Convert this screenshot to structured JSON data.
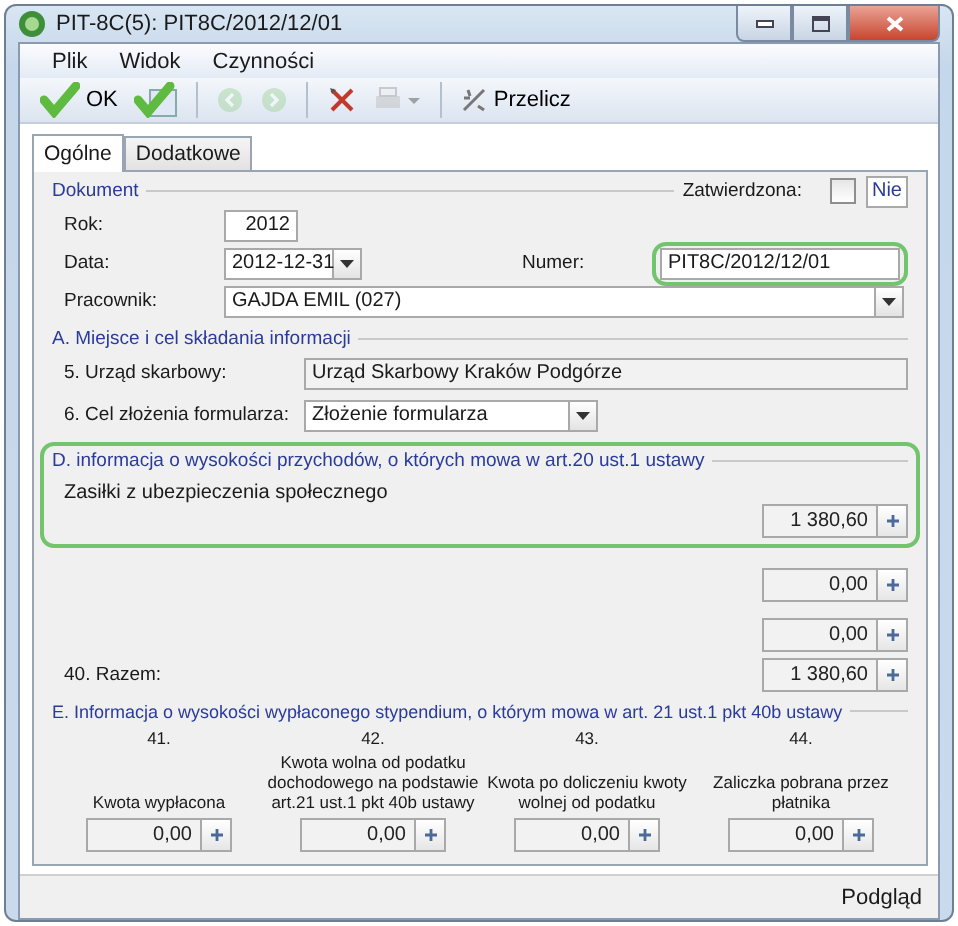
{
  "window": {
    "title": "PIT-8C(5): PIT8C/2012/12/01"
  },
  "menu": [
    "Plik",
    "Widok",
    "Czynności"
  ],
  "toolbar": [
    {
      "kind": "ok",
      "label": "OK",
      "disabled": false
    },
    {
      "kind": "check",
      "disabled": false
    },
    {
      "kind": "prev",
      "disabled": true
    },
    {
      "kind": "next",
      "disabled": true
    },
    {
      "kind": "tools",
      "disabled": false
    },
    {
      "kind": "print",
      "disabled": true
    },
    {
      "kind": "recalc",
      "label": "Przelicz",
      "disabled": false
    }
  ],
  "tabs": [
    {
      "label": "Ogólne",
      "selected": true
    },
    {
      "label": "Dodatkowe",
      "selected": false
    }
  ],
  "document": {
    "legend": "Dokument",
    "approved_label": "Zatwierdzona:",
    "approved": false,
    "approved_text": "Nie",
    "year_label": "Rok:",
    "year": "2012",
    "date_label": "Data:",
    "date": "2012-12-31",
    "number_label": "Numer:",
    "number": "PIT8C/2012/12/01",
    "number_highlighted": true,
    "employee_label": "Pracownik:",
    "employee": "GAJDA EMIL (027)"
  },
  "section_a": {
    "legend": "A. Miejsce i cel składania informacji",
    "office_label": "5. Urząd skarbowy:",
    "office": "Urząd Skarbowy Kraków Podgórze",
    "purpose_label": "6. Cel złożenia formularza:",
    "purpose": "Złożenie formularza"
  },
  "section_d": {
    "legend": "D. informacja o wysokości przychodów, o których mowa w art.20 ust.1 ustawy",
    "highlighted": true,
    "item_label": "Zasiłki z ubezpieczenia społecznego",
    "item_value": "1 380,60",
    "extra_values": [
      "0,00",
      "0,00"
    ],
    "total_label": "40. Razem:",
    "total": "1 380,60"
  },
  "section_e": {
    "legend": "E. Informacja o wysokości wypłaconego stypendium, o którym mowa w art. 21 ust.1 pkt 40b ustawy",
    "columns": [
      {
        "number": "41.",
        "label": "Kwota wypłacona",
        "value": "0,00"
      },
      {
        "number": "42.",
        "label": "Kwota wolna od podatku dochodowego na podstawie art.21 ust.1 pkt 40b ustawy",
        "value": "0,00"
      },
      {
        "number": "43.",
        "label": "Kwota po doliczeniu kwoty wolnej od podatku",
        "value": "0,00"
      },
      {
        "number": "44.",
        "label": "Zaliczka pobrana przez płatnika",
        "value": "0,00"
      }
    ]
  },
  "status_bar": "Podgląd"
}
